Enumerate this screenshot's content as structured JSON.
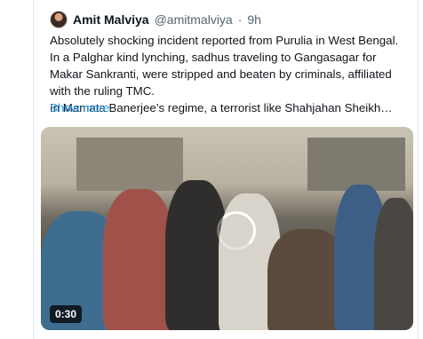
{
  "tweet": {
    "author_name": "Amit Malviya",
    "handle": "@amitmalviya",
    "separator": "·",
    "time": "9h",
    "text_paragraph_1": "Absolutely shocking incident reported from Purulia in West Bengal. In a Palghar kind lynching, sadhus traveling to Gangasagar for Makar Sankranti, were stripped and beaten by criminals, affiliated with the ruling TMC.",
    "text_paragraph_2": "In Mamata Banerjee’s regime, a terrorist like Shahjahan Sheikh…",
    "show_more": "Show more"
  },
  "video": {
    "duration": "0:30"
  },
  "colors": {
    "link": "#1d9bf0",
    "text": "#0f1419",
    "secondary_text": "#536471"
  }
}
